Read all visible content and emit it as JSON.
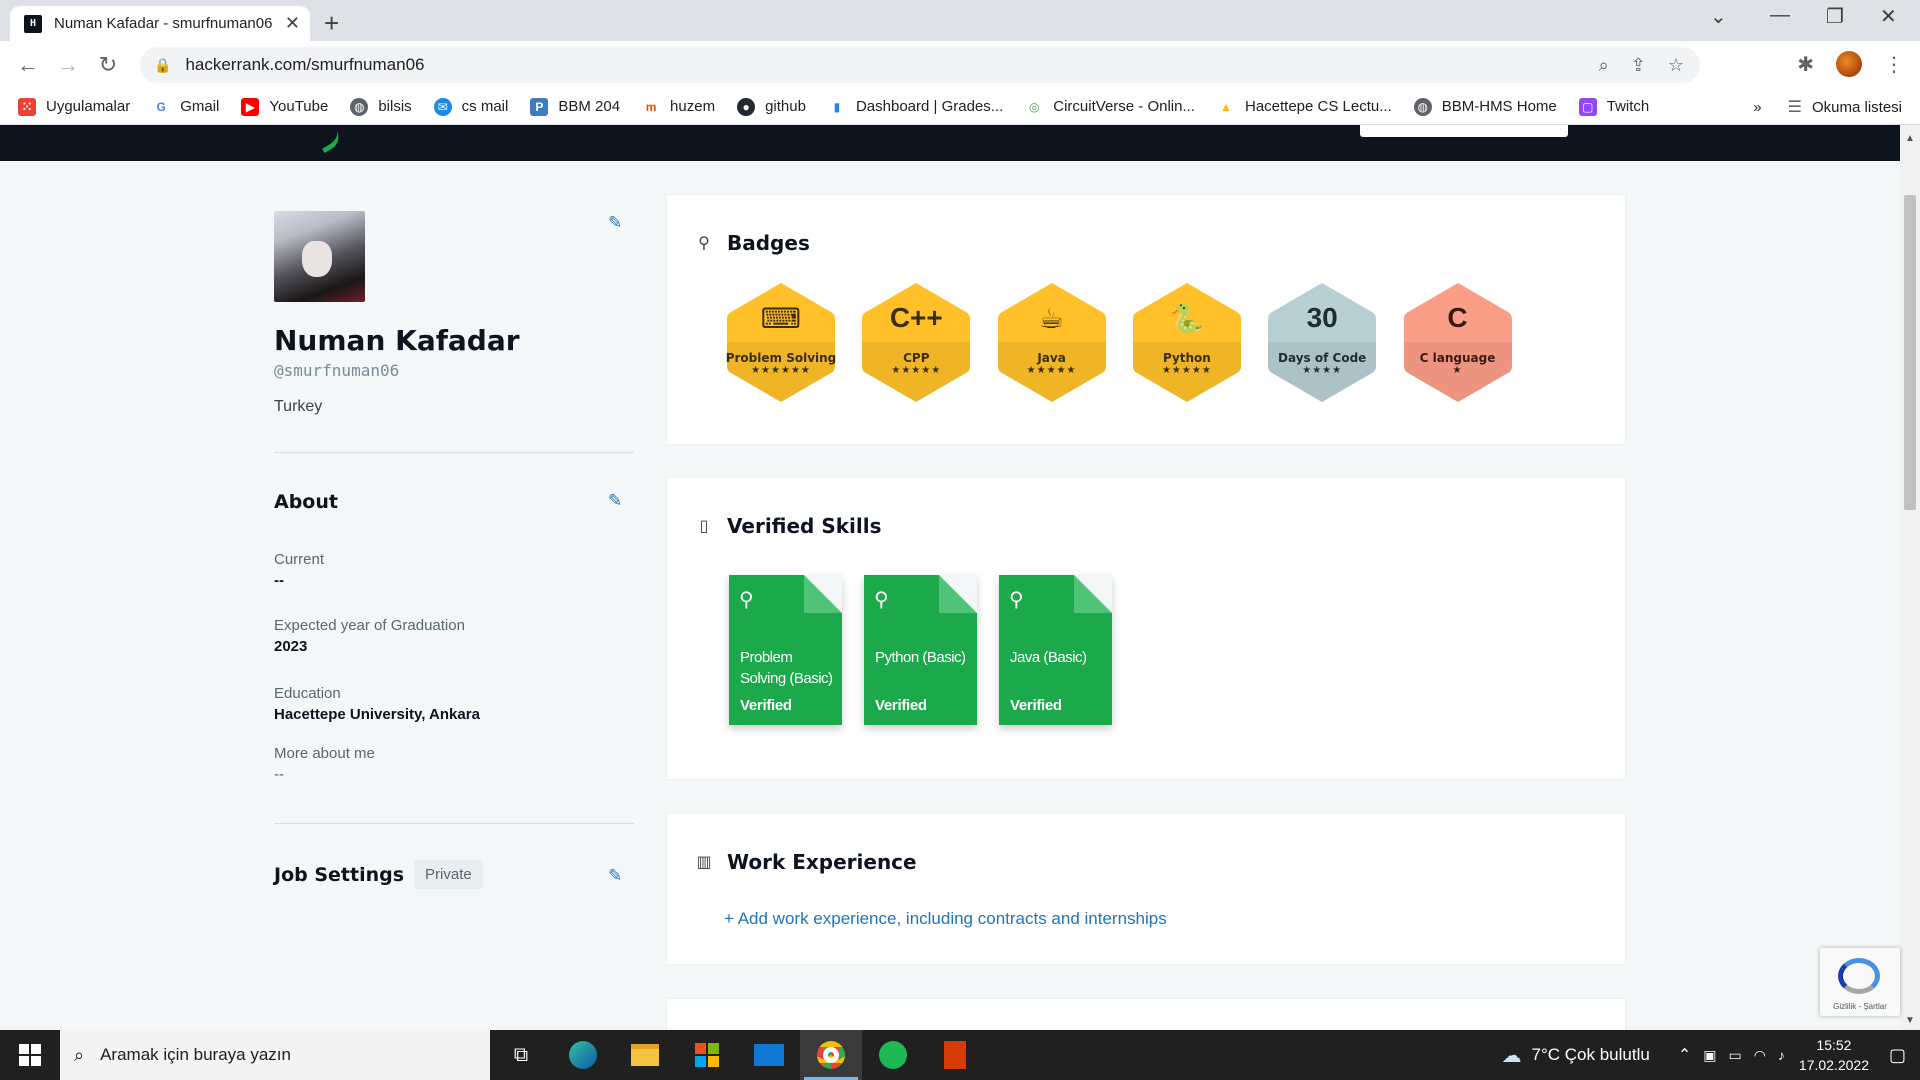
{
  "browser": {
    "tab_title": "Numan Kafadar - smurfnuman06",
    "url": "hackerrank.com/smurfnuman06",
    "favicon_text": "H"
  },
  "bookmarks": {
    "items": [
      {
        "label": "Uygulamalar",
        "icon": "apps-grid-icon",
        "color": "#ea4335"
      },
      {
        "label": "Gmail",
        "icon": "google-icon",
        "color": "#4285f4"
      },
      {
        "label": "YouTube",
        "icon": "youtube-icon",
        "color": "#ff0000"
      },
      {
        "label": "bilsis",
        "icon": "globe-icon",
        "color": "#5f6368"
      },
      {
        "label": "cs mail",
        "icon": "mail-icon",
        "color": "#1e88e5"
      },
      {
        "label": "BBM 204",
        "icon": "piazza-icon",
        "color": "#3e7bbf"
      },
      {
        "label": "huzem",
        "icon": "huzem-icon",
        "color": "#e65100"
      },
      {
        "label": "github",
        "icon": "github-icon",
        "color": "#24292e"
      },
      {
        "label": "Dashboard | Grades...",
        "icon": "chart-icon",
        "color": "#1e88e5"
      },
      {
        "label": "CircuitVerse - Onlin...",
        "icon": "circuit-icon",
        "color": "#43a047"
      },
      {
        "label": "Hacettepe CS Lectu...",
        "icon": "drive-icon",
        "color": "#fbbc04"
      },
      {
        "label": "BBM-HMS Home",
        "icon": "globe-icon",
        "color": "#5f6368"
      },
      {
        "label": "Twitch",
        "icon": "twitch-icon",
        "color": "#9146ff"
      }
    ],
    "more": "»",
    "reading_list": "Okuma listesi"
  },
  "profile": {
    "name": "Numan Kafadar",
    "handle": "@smurfnuman06",
    "country": "Turkey"
  },
  "about": {
    "title": "About",
    "fields": [
      {
        "label": "Current",
        "value": "--"
      },
      {
        "label": "Expected year of Graduation",
        "value": "2023"
      },
      {
        "label": "Education",
        "value": "Hacettepe University, Ankara"
      },
      {
        "label": "More about me",
        "value": "--"
      }
    ]
  },
  "job_settings": {
    "title": "Job Settings",
    "tag": "Private"
  },
  "badges": {
    "title": "Badges",
    "items": [
      {
        "name": "Problem Solving",
        "icon_text": "⌨",
        "stars": "★★★★★★",
        "color": "#ffc02a",
        "text_color": "#3a2e0b"
      },
      {
        "name": "CPP",
        "icon_text": "C++",
        "stars": "★★★★★",
        "color": "#ffc02a",
        "text_color": "#3a2e0b"
      },
      {
        "name": "Java",
        "icon_text": "☕",
        "stars": "★★★★★",
        "color": "#ffc02a",
        "text_color": "#3a2e0b"
      },
      {
        "name": "Python",
        "icon_text": "🐍",
        "stars": "★★★★★",
        "color": "#ffc02a",
        "text_color": "#3a2e0b"
      },
      {
        "name": "Days of Code",
        "icon_text": "30",
        "stars": "★★★★",
        "color": "#b8cfd4",
        "text_color": "#1f2d33"
      },
      {
        "name": "C language",
        "icon_text": "C",
        "stars": "★",
        "color": "#fb9e87",
        "text_color": "#3a1a10"
      }
    ]
  },
  "verified_skills": {
    "title": "Verified Skills",
    "items": [
      {
        "name": "Problem Solving (Basic)",
        "status": "Verified"
      },
      {
        "name": "Python (Basic)",
        "status": "Verified"
      },
      {
        "name": "Java (Basic)",
        "status": "Verified"
      }
    ]
  },
  "work_experience": {
    "title": "Work Experience",
    "add_link": "+ Add work experience, including contracts and internships"
  },
  "recaptcha": {
    "text": "Gizlilik - Şartlar"
  },
  "taskbar": {
    "search_placeholder": "Aramak için buraya yazın",
    "weather": "7°C  Çok bulutlu",
    "time": "15:52",
    "date": "17.02.2022"
  },
  "colors": {
    "accent_green": "#1ba94c",
    "link_blue": "#1f74ba",
    "site_header": "#0e141e"
  }
}
